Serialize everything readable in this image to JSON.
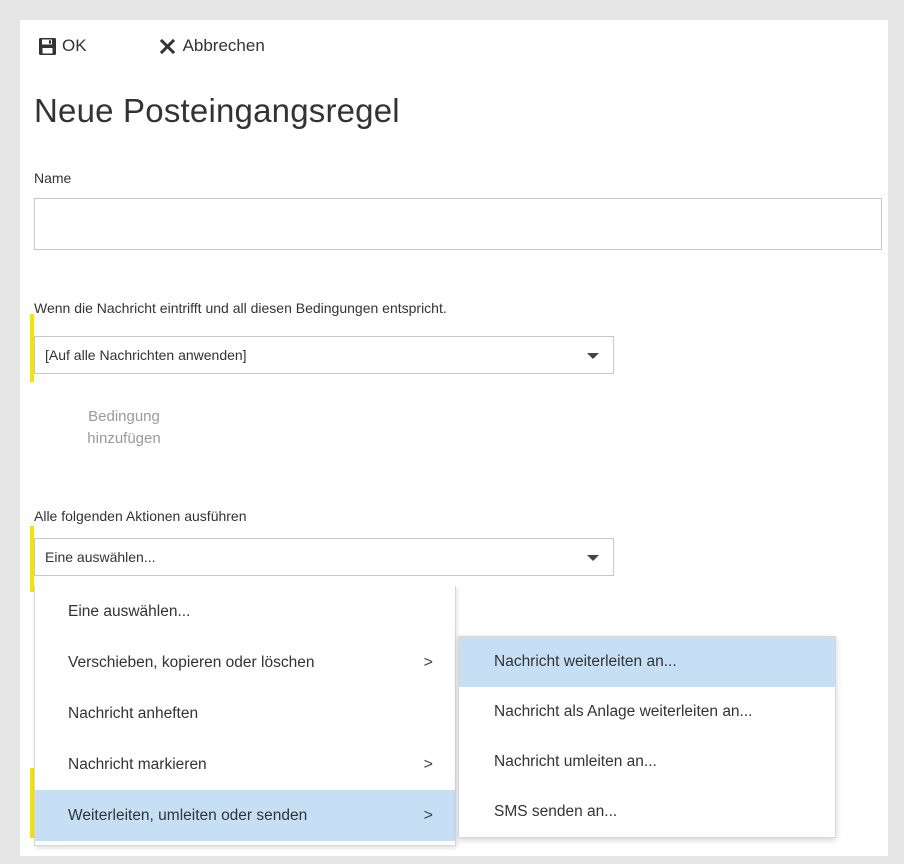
{
  "toolbar": {
    "ok_label": "OK",
    "ok_icon": "save-icon",
    "cancel_label": "Abbrechen",
    "cancel_icon": "close-icon"
  },
  "page": {
    "title": "Neue Posteingangsregel"
  },
  "name_field": {
    "label": "Name",
    "value": ""
  },
  "conditions": {
    "label": "Wenn die Nachricht eintrifft und all diesen Bedingungen entspricht.",
    "selected": "[Auf alle Nachrichten anwenden]",
    "add_label_line1": "Bedingung",
    "add_label_line2": "hinzufügen"
  },
  "actions": {
    "label": "Alle folgenden Aktionen ausführen",
    "selected": "Eine auswählen..."
  },
  "action_menu": {
    "items": [
      {
        "label": "Eine auswählen...",
        "has_submenu": false
      },
      {
        "label": "Verschieben, kopieren oder löschen",
        "has_submenu": true
      },
      {
        "label": "Nachricht anheften",
        "has_submenu": false
      },
      {
        "label": "Nachricht markieren",
        "has_submenu": true
      },
      {
        "label": "Weiterleiten, umleiten oder senden",
        "has_submenu": true,
        "selected": true
      }
    ],
    "chevron": ">"
  },
  "submenu": {
    "items": [
      {
        "label": "Nachricht weiterleiten an...",
        "selected": true
      },
      {
        "label": "Nachricht als Anlage weiterleiten an..."
      },
      {
        "label": "Nachricht umleiten an..."
      },
      {
        "label": "SMS senden an..."
      }
    ]
  },
  "colors": {
    "highlight": "#c7dff5",
    "marker": "#f2e600",
    "background": "#e6e6e6"
  }
}
